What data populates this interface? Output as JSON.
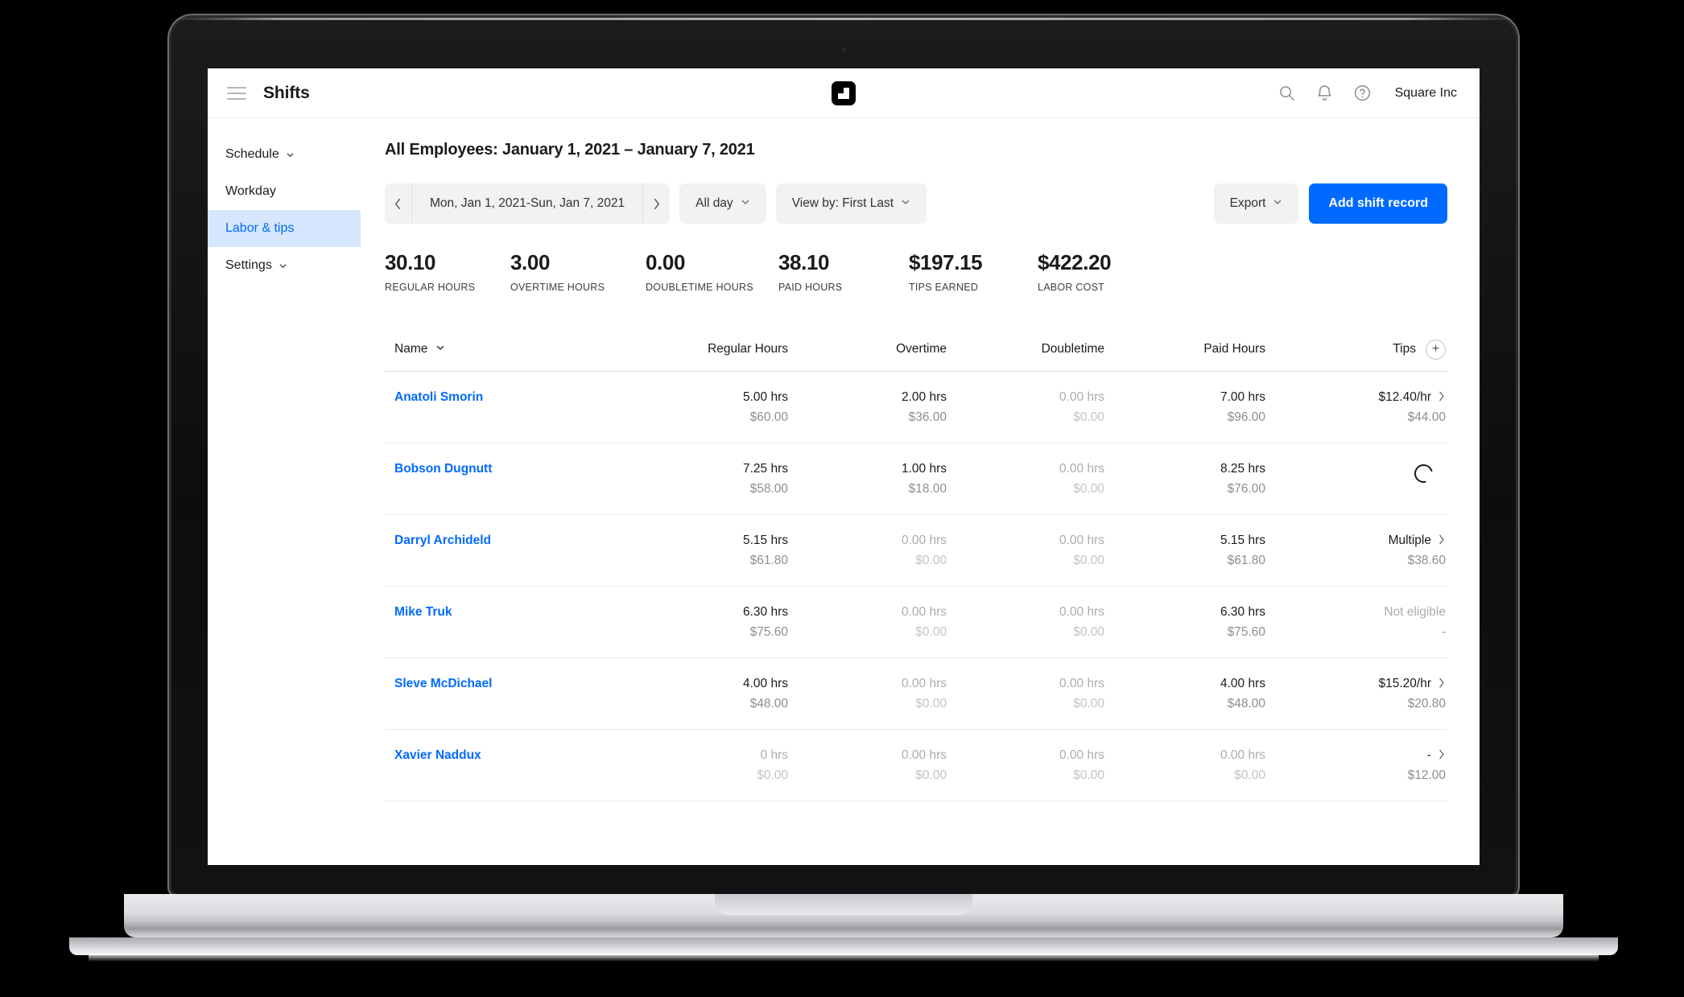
{
  "header": {
    "menu_icon": "hamburger-icon",
    "title": "Shifts",
    "logo": "square-logo",
    "search_icon": "search-icon",
    "notifications_icon": "bell-icon",
    "help_icon": "question-circle-icon",
    "org_name": "Square Inc"
  },
  "sidebar": {
    "items": [
      {
        "label": "Schedule",
        "has_chevron": true,
        "active": false
      },
      {
        "label": "Workday",
        "has_chevron": false,
        "active": false
      },
      {
        "label": "Labor & tips",
        "has_chevron": false,
        "active": true
      },
      {
        "label": "Settings",
        "has_chevron": true,
        "active": false
      }
    ]
  },
  "page": {
    "title": "All Employees: January 1, 2021 – January 7, 2021"
  },
  "toolbar": {
    "prev_label": "‹",
    "date_range": "Mon, Jan 1, 2021-Sun, Jan 7, 2021",
    "next_label": "›",
    "time_filter": "All day",
    "view_by": "View by: First Last",
    "export_label": "Export",
    "add_shift_label": "Add shift record"
  },
  "stats": [
    {
      "value": "30.10",
      "label": "REGULAR HOURS"
    },
    {
      "value": "3.00",
      "label": "OVERTIME HOURS"
    },
    {
      "value": "0.00",
      "label": "DOUBLETIME HOURS"
    },
    {
      "value": "38.10",
      "label": "PAID HOURS"
    },
    {
      "value": "$197.15",
      "label": "TIPS EARNED"
    },
    {
      "value": "$422.20",
      "label": "LABOR COST"
    }
  ],
  "table": {
    "columns": [
      "Name",
      "Regular Hours",
      "Overtime",
      "Doubletime",
      "Paid Hours",
      "Tips"
    ],
    "add_column_label": "+",
    "rows": [
      {
        "name": "Anatoli Smorin",
        "regular": {
          "hours": "5.00 hrs",
          "amount": "$60.00",
          "muted": false
        },
        "overtime": {
          "hours": "2.00 hrs",
          "amount": "$36.00",
          "muted": false
        },
        "doubletime": {
          "hours": "0.00 hrs",
          "amount": "$0.00",
          "muted": true
        },
        "paid": {
          "hours": "7.00 hrs",
          "amount": "$96.00",
          "muted": false
        },
        "tips": {
          "kind": "link",
          "label": "$12.40/hr",
          "amount": "$44.00"
        }
      },
      {
        "name": "Bobson Dugnutt",
        "regular": {
          "hours": "7.25 hrs",
          "amount": "$58.00",
          "muted": false
        },
        "overtime": {
          "hours": "1.00 hrs",
          "amount": "$18.00",
          "muted": false
        },
        "doubletime": {
          "hours": "0.00 hrs",
          "amount": "$0.00",
          "muted": true
        },
        "paid": {
          "hours": "8.25 hrs",
          "amount": "$76.00",
          "muted": false
        },
        "tips": {
          "kind": "loading",
          "label": "",
          "amount": ""
        }
      },
      {
        "name": "Darryl Archideld",
        "regular": {
          "hours": "5.15 hrs",
          "amount": "$61.80",
          "muted": false
        },
        "overtime": {
          "hours": "0.00 hrs",
          "amount": "$0.00",
          "muted": true
        },
        "doubletime": {
          "hours": "0.00 hrs",
          "amount": "$0.00",
          "muted": true
        },
        "paid": {
          "hours": "5.15 hrs",
          "amount": "$61.80",
          "muted": false
        },
        "tips": {
          "kind": "link",
          "label": "Multiple",
          "amount": "$38.60"
        }
      },
      {
        "name": "Mike Truk",
        "regular": {
          "hours": "6.30 hrs",
          "amount": "$75.60",
          "muted": false
        },
        "overtime": {
          "hours": "0.00 hrs",
          "amount": "$0.00",
          "muted": true
        },
        "doubletime": {
          "hours": "0.00 hrs",
          "amount": "$0.00",
          "muted": true
        },
        "paid": {
          "hours": "6.30 hrs",
          "amount": "$75.60",
          "muted": false
        },
        "tips": {
          "kind": "disabled",
          "label": "Not eligible",
          "amount": "-"
        }
      },
      {
        "name": "Sleve McDichael",
        "regular": {
          "hours": "4.00 hrs",
          "amount": "$48.00",
          "muted": false
        },
        "overtime": {
          "hours": "0.00 hrs",
          "amount": "$0.00",
          "muted": true
        },
        "doubletime": {
          "hours": "0.00 hrs",
          "amount": "$0.00",
          "muted": true
        },
        "paid": {
          "hours": "4.00 hrs",
          "amount": "$48.00",
          "muted": false
        },
        "tips": {
          "kind": "link",
          "label": "$15.20/hr",
          "amount": "$20.80"
        }
      },
      {
        "name": "Xavier Naddux",
        "regular": {
          "hours": "0 hrs",
          "amount": "$0.00",
          "muted": true
        },
        "overtime": {
          "hours": "0.00 hrs",
          "amount": "$0.00",
          "muted": true
        },
        "doubletime": {
          "hours": "0.00 hrs",
          "amount": "$0.00",
          "muted": true
        },
        "paid": {
          "hours": "0.00 hrs",
          "amount": "$0.00",
          "muted": true
        },
        "tips": {
          "kind": "link",
          "label": "-",
          "amount": "$12.00"
        }
      }
    ]
  },
  "colors": {
    "accent": "#006aff",
    "sidebar_active_bg": "#d6e7fd",
    "pill_bg": "#f2f2f2",
    "text": "#1b1b1b",
    "muted": "#a9adb1"
  }
}
